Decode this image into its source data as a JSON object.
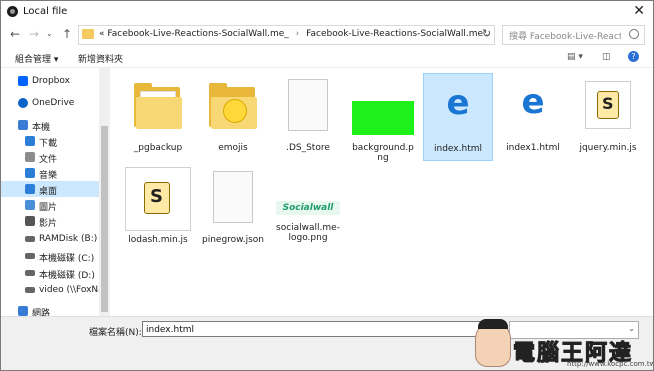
{
  "window": {
    "title": "Local file"
  },
  "address": {
    "crumbs": [
      "Facebook-Live-Reactions-SocialWall.me_",
      "Facebook-Live-Reactions-SocialWall.me"
    ],
    "prefix": "«"
  },
  "search": {
    "placeholder": "搜尋 Facebook-Live-Reactio..."
  },
  "toolbar": {
    "organize": "組合管理 ▾",
    "new_folder": "新增資料夾"
  },
  "nav": {
    "items": [
      {
        "label": "Dropbox",
        "icon": "dropbox-icon",
        "color": "#0061fe"
      },
      {
        "label": "OneDrive",
        "icon": "onedrive-icon",
        "color": "#0a64c8"
      },
      {
        "label": "本機",
        "icon": "computer-icon",
        "color": "#3a7bd5"
      },
      {
        "label": "下載",
        "icon": "download-icon",
        "color": "#2b7fd8"
      },
      {
        "label": "文件",
        "icon": "documents-icon",
        "color": "#8c8c8c"
      },
      {
        "label": "音樂",
        "icon": "music-icon",
        "color": "#2b7fd8"
      },
      {
        "label": "桌面",
        "icon": "desktop-icon",
        "color": "#2b7fd8"
      },
      {
        "label": "圖片",
        "icon": "pictures-icon",
        "color": "#4a90d9"
      },
      {
        "label": "影片",
        "icon": "videos-icon",
        "color": "#555555"
      },
      {
        "label": "RAMDisk (B:)",
        "icon": "drive-icon",
        "color": "#666666"
      },
      {
        "label": "本機磁碟 (C:)",
        "icon": "drive-icon",
        "color": "#666666"
      },
      {
        "label": "本機磁碟 (D:)",
        "icon": "drive-icon",
        "color": "#666666"
      },
      {
        "label": "video (\\\\FoxNa",
        "icon": "network-drive-icon",
        "color": "#666666"
      },
      {
        "label": "網路",
        "icon": "network-icon",
        "color": "#3a7bd5"
      }
    ],
    "selected": "桌面"
  },
  "files": [
    {
      "name": "_pgbackup",
      "kind": "folder"
    },
    {
      "name": "emojis",
      "kind": "folder-emoji"
    },
    {
      "name": ".DS_Store",
      "kind": "blank"
    },
    {
      "name": "background.png",
      "kind": "green"
    },
    {
      "name": "index.html",
      "kind": "edge",
      "selected": true
    },
    {
      "name": "index1.html",
      "kind": "edge"
    },
    {
      "name": "jquery.min.js",
      "kind": "script"
    },
    {
      "name": "lodash.min.js",
      "kind": "script-large"
    },
    {
      "name": "pinegrow.json",
      "kind": "blank"
    },
    {
      "name": "socialwall.me-logo.png",
      "kind": "logo"
    }
  ],
  "logo_text": "Socialwall",
  "filename": {
    "label": "檔案名稱(N):",
    "value": "index.html"
  },
  "watermark": {
    "text": "電腦王阿達",
    "url": "http://www.kocpc.com.tw"
  }
}
